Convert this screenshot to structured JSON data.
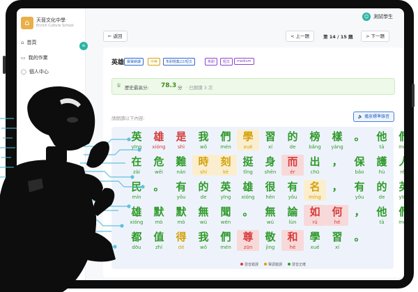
{
  "app": {
    "school_name": "天晉文化中學",
    "school_sub": "Enrich Culture School",
    "logo_icon": "building-icon"
  },
  "sidebar": {
    "items": [
      {
        "label": "首頁",
        "icon": "home-icon"
      },
      {
        "label": "我的作業",
        "icon": "document-icon"
      },
      {
        "label": "個人中心",
        "icon": "user-icon"
      }
    ],
    "collapse_label": "≡"
  },
  "header": {
    "user_name": "測試學生",
    "avatar_icon": "user-avatar-icon"
  },
  "toolbar": {
    "back_label": "← 返回",
    "prev_label": "< 上一題",
    "page_indicator": "第 14 / 15 題",
    "next_label": "> 下一題"
  },
  "exercise": {
    "title": "英雄",
    "tags": [
      {
        "label": "寶寶朗讀",
        "color": "#2d65c8"
      },
      {
        "label": "中等",
        "color": "#d4a10a"
      },
      {
        "label": "朱耐題集22/短文",
        "color": "#2d65c8"
      },
      {
        "label": "朱耐",
        "color": "#8a44c8"
      },
      {
        "label": "短文",
        "color": "#8a44c8"
      },
      {
        "label": "medium",
        "color": "#8a44c8"
      }
    ],
    "score_label": "歷史最高分:",
    "score_value": "78.3",
    "score_unit": "分",
    "score_tries": "· 已朗讀 3 次",
    "prompt": "請朗讀以下內容:",
    "listen_label": "🔈 播放標準錄音"
  },
  "passage": {
    "lines": [
      [
        [
          "英",
          "yīng",
          "g"
        ],
        [
          "雄",
          "xióng",
          "r"
        ],
        [
          "是",
          "shì",
          "r"
        ],
        [
          "我",
          "wǒ",
          "g"
        ],
        [
          "們",
          "mén",
          "g"
        ],
        [
          "學",
          "xué",
          "yh"
        ],
        [
          "習",
          "xí",
          "g"
        ],
        [
          "的",
          "de",
          "g"
        ],
        [
          "榜",
          "bǎng",
          "g"
        ],
        [
          "樣",
          "yàng",
          "g"
        ],
        [
          "。",
          "",
          ""
        ],
        [
          "他",
          "tā",
          "g"
        ],
        [
          "們",
          "mén",
          "g"
        ]
      ],
      [
        [
          "在",
          "zài",
          "g"
        ],
        [
          "危",
          "wēi",
          "g"
        ],
        [
          "難",
          "nán",
          "g"
        ],
        [
          "時",
          "shí",
          "yh"
        ],
        [
          "刻",
          "kè",
          "yh"
        ],
        [
          "挺",
          "tǐng",
          "g"
        ],
        [
          "身",
          "shēn",
          "g"
        ],
        [
          "而",
          "ér",
          "rh"
        ],
        [
          "出",
          "chū",
          "g"
        ],
        [
          "，",
          "",
          ""
        ],
        [
          "保",
          "bǎo",
          "g"
        ],
        [
          "護",
          "hù",
          "g"
        ],
        [
          "人",
          "rén",
          "g"
        ]
      ],
      [
        [
          "民",
          "mín",
          "g"
        ],
        [
          "。",
          "",
          ""
        ],
        [
          "有",
          "yǒu",
          "g"
        ],
        [
          "的",
          "de",
          "g"
        ],
        [
          "英",
          "yīng",
          "g"
        ],
        [
          "雄",
          "xióng",
          "g"
        ],
        [
          "很",
          "hěn",
          "g"
        ],
        [
          "有",
          "yǒu",
          "g"
        ],
        [
          "名",
          "míng",
          "yh"
        ],
        [
          "，",
          "",
          ""
        ],
        [
          "有",
          "yǒu",
          "g"
        ],
        [
          "的",
          "de",
          "g"
        ],
        [
          "英",
          "yīng",
          "g"
        ]
      ],
      [
        [
          "雄",
          "xióng",
          "g"
        ],
        [
          "默",
          "mò",
          "g"
        ],
        [
          "默",
          "mò",
          "g"
        ],
        [
          "無",
          "wú",
          "g"
        ],
        [
          "聞",
          "wén",
          "g"
        ],
        [
          "。",
          "",
          ""
        ],
        [
          "無",
          "wú",
          "g"
        ],
        [
          "論",
          "lùn",
          "g"
        ],
        [
          "如",
          "rú",
          "rh"
        ],
        [
          "何",
          "hé",
          "rh"
        ],
        [
          "，",
          "",
          ""
        ],
        [
          "他",
          "tā",
          "g"
        ],
        [
          "們",
          "mén",
          "g"
        ]
      ],
      [
        [
          "都",
          "dōu",
          "g"
        ],
        [
          "值",
          "zhí",
          "g"
        ],
        [
          "得",
          "dé",
          "y"
        ],
        [
          "我",
          "wǒ",
          "g"
        ],
        [
          "們",
          "mén",
          "g"
        ],
        [
          "尊",
          "zūn",
          "rh"
        ],
        [
          "敬",
          "jìng",
          "g"
        ],
        [
          "和",
          "hé",
          "rh"
        ],
        [
          "學",
          "xué",
          "g"
        ],
        [
          "習",
          "xí",
          "g"
        ],
        [
          "。",
          "",
          ""
        ]
      ]
    ],
    "legend": [
      {
        "label": "發音錯誤",
        "color": "#d63b3b"
      },
      {
        "label": "聲調錯誤",
        "color": "#d4a10a"
      },
      {
        "label": "發音正確",
        "color": "#2f9a2a"
      }
    ]
  },
  "overlay": {
    "robot_icon": "thinking-robot-icon",
    "circuit_icon": "circuit-lines-icon"
  }
}
